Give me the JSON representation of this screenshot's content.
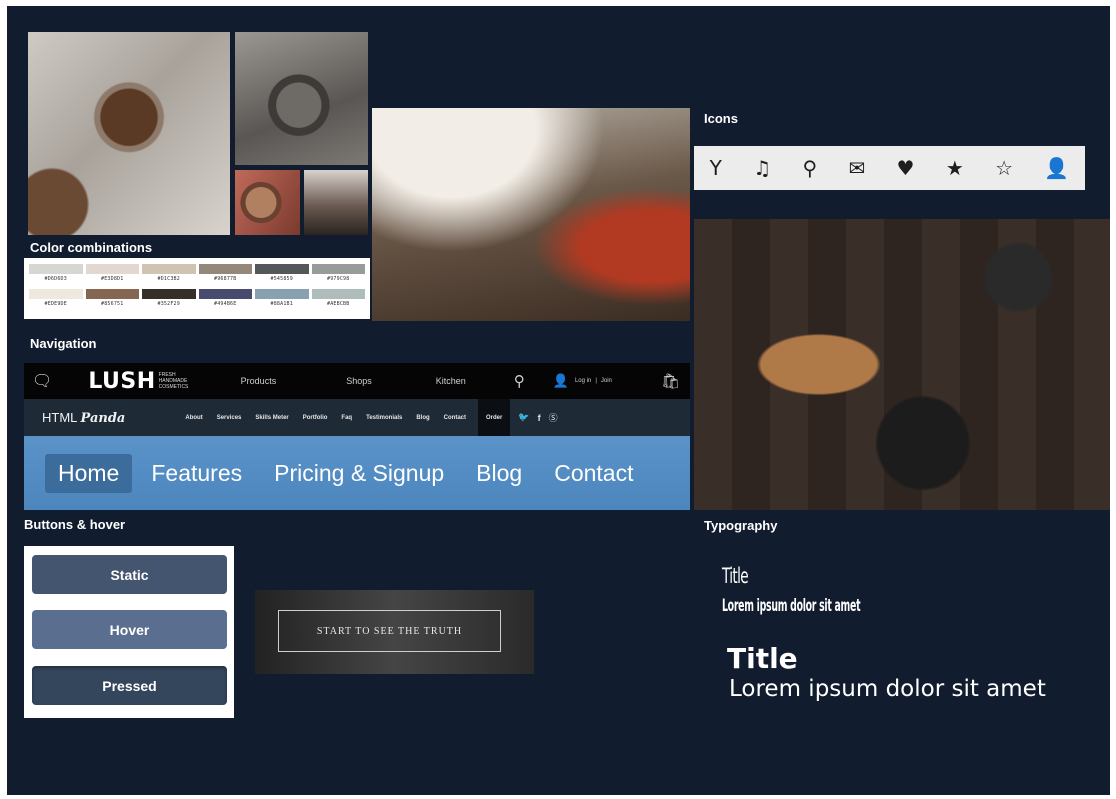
{
  "sections": {
    "color_combinations": "Color combinations",
    "navigation": "Navigation",
    "buttons_hover": "Buttons & hover",
    "icons": "Icons",
    "typography": "Typography"
  },
  "palette": {
    "row1": [
      {
        "code": "#D6D6D3",
        "color": "#D6D6D3"
      },
      {
        "code": "#E3D8D1",
        "color": "#E3D8D1"
      },
      {
        "code": "#D1C3B2",
        "color": "#D1C3B2"
      },
      {
        "code": "#96877B",
        "color": "#96877B"
      },
      {
        "code": "#545859",
        "color": "#545859"
      },
      {
        "code": "#979C98",
        "color": "#979C98"
      }
    ],
    "row2": [
      {
        "code": "#EDE9DE",
        "color": "#EDE9DE"
      },
      {
        "code": "#856751",
        "color": "#856751"
      },
      {
        "code": "#352F29",
        "color": "#352F29"
      },
      {
        "code": "#494B6E",
        "color": "#494B6E"
      },
      {
        "code": "#88A1B1",
        "color": "#88A1B1"
      },
      {
        "code": "#AEBCBB",
        "color": "#AEBCBB"
      }
    ]
  },
  "nav_lush": {
    "logo": "LUSH",
    "tagline": "FRESH HANDMADE COSMETICS",
    "items": [
      "Products",
      "Shops",
      "Kitchen"
    ],
    "login": "Log in",
    "join": "Join"
  },
  "nav_panda": {
    "brand_prefix": "HTML",
    "brand_name": "Panda",
    "items": [
      "About",
      "Services",
      "Skills Meter",
      "Portfolio",
      "Faq",
      "Testimonials",
      "Blog",
      "Contact"
    ],
    "order": "Order"
  },
  "nav_main": {
    "items": [
      "Home",
      "Features",
      "Pricing & Signup",
      "Blog",
      "Contact"
    ],
    "active": "Home"
  },
  "icons": [
    "filter-icon",
    "music-icon",
    "search-icon",
    "envelope-icon",
    "heart-icon",
    "star-icon",
    "star-outline-icon",
    "user-icon"
  ],
  "buttons": {
    "static": "Static",
    "hover": "Hover",
    "pressed": "Pressed"
  },
  "truth_button": "START TO SEE THE TRUTH",
  "typography": {
    "condensed_title": "Title",
    "condensed_sub": "Lorem ipsum dolor sit amet",
    "sans_title": "Title",
    "sans_sub": "Lorem ipsum dolor sit amet"
  }
}
